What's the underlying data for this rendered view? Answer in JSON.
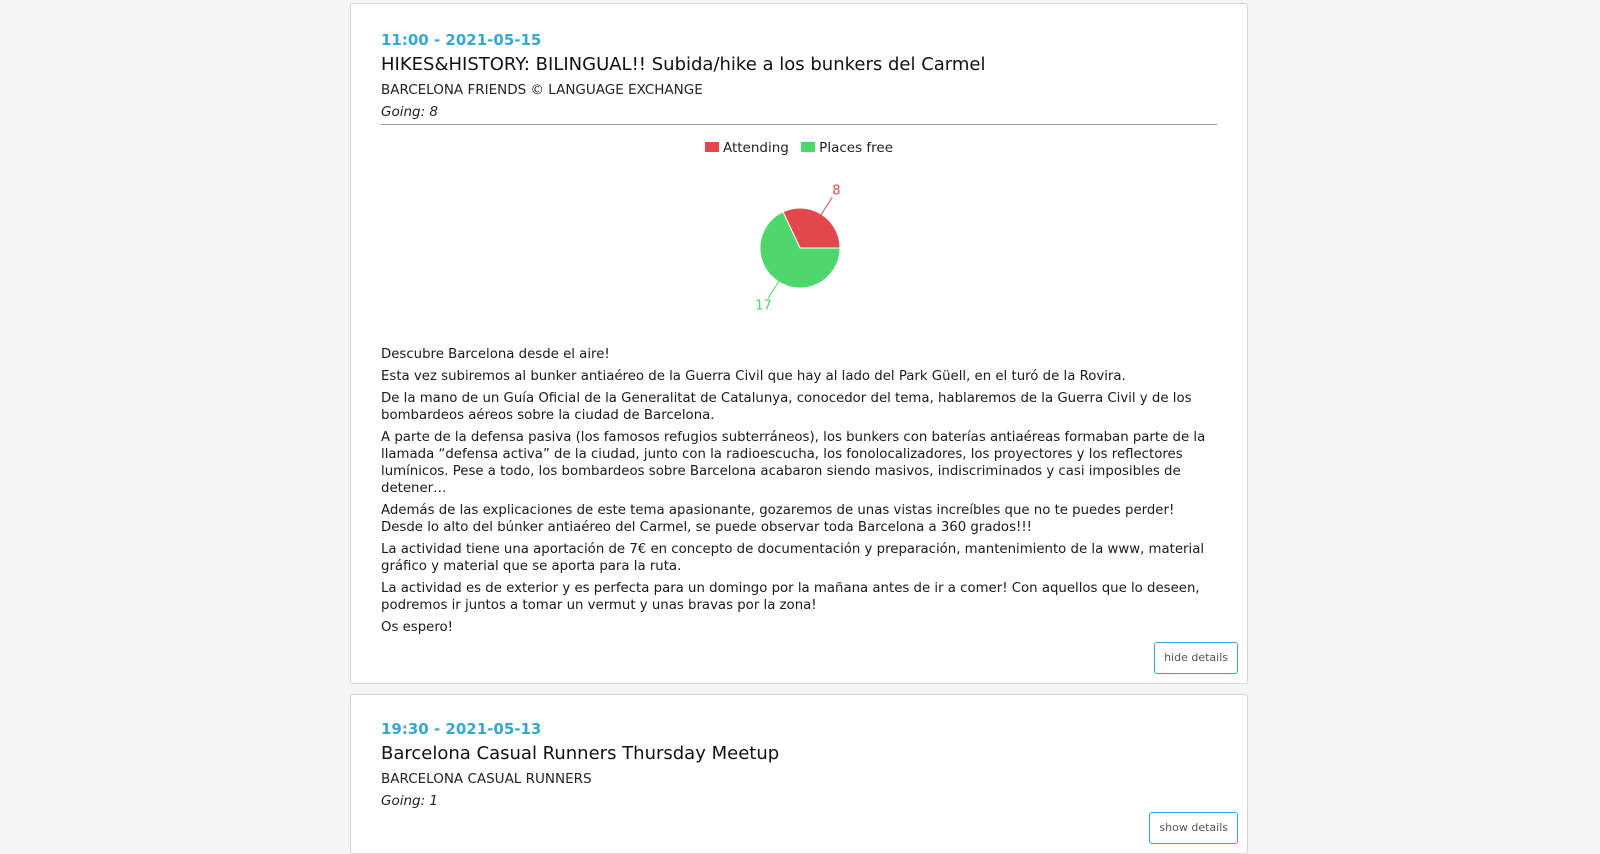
{
  "events": [
    {
      "time": "11:00 - 2021-05-15",
      "title": "HIKES&HISTORY: BILINGUAL!! Subida/hike a los bunkers del Carmel",
      "group": "BARCELONA FRIENDS © LANGUAGE EXCHANGE",
      "going": "Going: 8",
      "description": [
        "Descubre Barcelona desde el aire!",
        "Esta vez subiremos al bunker antiaéreo de la Guerra Civil que hay al lado del Park Güell, en el turó de la Rovira.",
        "De la mano de un Guía Oficial de la Generalitat de Catalunya, conocedor del tema, hablaremos de la Guerra Civil y de los bombardeos aéreos sobre la ciudad de Barcelona.",
        "A parte de la defensa pasiva (los famosos refugios subterráneos), los bunkers con baterías antiaéreas formaban parte de la llamada “defensa activa” de la ciudad, junto con la radioescucha, los fonolocalizadores, los proyectores y los reflectores lumínicos. Pese a todo, los bombardeos sobre Barcelona acabaron siendo masivos, indiscriminados y casi imposibles de detener…",
        "Además de las explicaciones de este tema apasionante, gozaremos de unas vistas increíbles que no te puedes perder! Desde lo alto del búnker antiaéreo del Carmel, se puede observar toda Barcelona a 360 grados!!!",
        "La actividad tiene una aportación de 7€ en concepto de documentación y preparación, mantenimiento de la www, material gráfico y material que se aporta para la ruta.",
        "La actividad es de exterior y es perfecta para un domingo por la mañana antes de ir a comer! Con aquellos que lo deseen, podremos ir juntos a tomar un vermut y unas bravas por la zona!",
        "Os espero!"
      ],
      "button_label": "hide details"
    },
    {
      "time": "19:30 - 2021-05-13",
      "title": "Barcelona Casual Runners Thursday Meetup",
      "group": "BARCELONA CASUAL RUNNERS",
      "going": "Going: 1",
      "button_label": "show details"
    }
  ],
  "chart_data": {
    "type": "pie",
    "legend": [
      "Attending",
      "Places free"
    ],
    "legend_position": "top",
    "values": [
      8,
      17
    ],
    "labels": [
      "8",
      "17"
    ],
    "colors": [
      "#e2474c",
      "#4cd66b"
    ]
  },
  "colors": {
    "accent": "#35a7d1",
    "attending": "#e2474c",
    "free": "#4cd66b"
  }
}
